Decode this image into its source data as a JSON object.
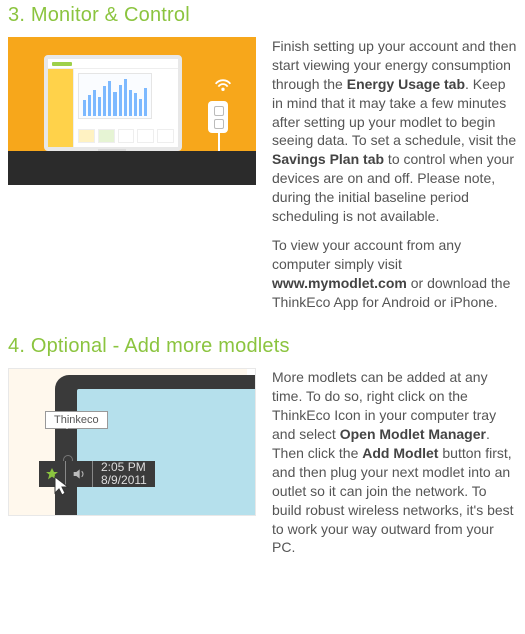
{
  "section3": {
    "heading": "3. Monitor & Control",
    "p1_a": "Finish setting up your account and then start viewing your energy consumption through the ",
    "p1_bold1": "Energy Usage tab",
    "p1_b": ". Keep in mind that it may take a few minutes after setting up your modlet to begin seeing data. To set a schedule, visit the ",
    "p1_bold2": "Savings Plan tab",
    "p1_c": " to control when your devices are on and off. Please note, during the initial baseline period scheduling is not available.",
    "p2_a": "To view your account from any computer simply visit ",
    "p2_bold1": "www.mymodlet.com",
    "p2_b": " or download the ThinkEco App for Android or iPhone."
  },
  "section4": {
    "heading": "4. Optional - Add more modlets",
    "p1_a": "More modlets can be added at any time. To do so, right click on the ThinkEco Icon in your computer tray and select ",
    "p1_bold1": "Open Modlet Manager",
    "p1_b": ". Then click the ",
    "p1_bold2": "Add Modlet",
    "p1_c": " button first, and then plug your next modlet into an outlet so it can join the network. To build robust wireless networks, it's best to work your way outward from your PC."
  },
  "illus2": {
    "tooltip": "Thinkeco",
    "time": "2:05 PM",
    "date": "8/9/2011"
  },
  "chart_data": {
    "type": "bar",
    "note": "decorative energy-usage bar chart on monitor screen; values approximate relative heights",
    "values": [
      18,
      24,
      30,
      22,
      34,
      40,
      28,
      36,
      42,
      30,
      26,
      20,
      32
    ],
    "ylim": [
      0,
      46
    ]
  }
}
